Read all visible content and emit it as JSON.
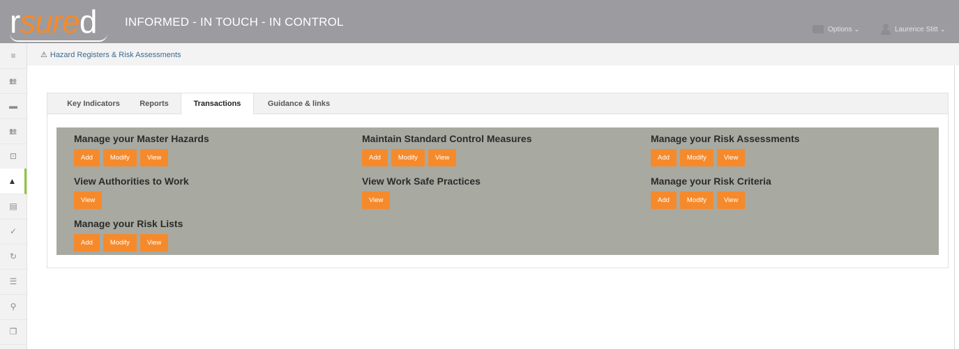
{
  "header": {
    "logo_r": "r",
    "logo_sure": "sure",
    "logo_d": "d",
    "tagline": "INFORMED - IN TOUCH - IN CONTROL",
    "options_label": "Options ⌄",
    "user_label": "Laurence Stitt ⌄"
  },
  "sidebar": {
    "items": [
      {
        "icon": "menu-icon",
        "glyph": "≡"
      },
      {
        "icon": "people-icon",
        "glyph": "👥"
      },
      {
        "icon": "truck-icon",
        "glyph": "▬"
      },
      {
        "icon": "group-icon",
        "glyph": "👥"
      },
      {
        "icon": "briefcase-icon",
        "glyph": "⊡"
      },
      {
        "icon": "warning-icon",
        "glyph": "▲",
        "active": true
      },
      {
        "icon": "book-icon",
        "glyph": "▤"
      },
      {
        "icon": "check-icon",
        "glyph": "✓"
      },
      {
        "icon": "refresh-icon",
        "glyph": "↻"
      },
      {
        "icon": "list-icon",
        "glyph": "☰"
      },
      {
        "icon": "map-marker-icon",
        "glyph": "⚲"
      },
      {
        "icon": "copy-icon",
        "glyph": "❐"
      }
    ]
  },
  "breadcrumb": {
    "icon": "⚠",
    "label": "Hazard Registers & Risk Assessments"
  },
  "tabs": [
    {
      "label": "Key Indicators"
    },
    {
      "label": "Reports"
    },
    {
      "label": "Transactions",
      "active": true
    },
    {
      "label": "Guidance & links"
    }
  ],
  "sections": [
    {
      "title": "Manage your Master Hazards",
      "buttons": [
        "Add",
        "Modify",
        "View"
      ]
    },
    {
      "title": "Maintain Standard Control Measures",
      "buttons": [
        "Add",
        "Modify",
        "View"
      ]
    },
    {
      "title": "Manage your Risk Assessments",
      "buttons": [
        "Add",
        "Modify",
        "View"
      ]
    },
    {
      "title": "View Authorities to Work",
      "buttons": [
        "View"
      ]
    },
    {
      "title": "View Work Safe Practices",
      "buttons": [
        "View"
      ]
    },
    {
      "title": "Manage your Risk Criteria",
      "buttons": [
        "Add",
        "Modify",
        "View"
      ]
    },
    {
      "title": "Manage your Risk Lists",
      "buttons": [
        "Add",
        "Modify",
        "View"
      ]
    }
  ],
  "colors": {
    "header_bg": "#9c9b9f",
    "accent_orange": "#f58a2c",
    "panel_grey": "#a8a9a1",
    "active_indicator": "#8cc63f"
  }
}
